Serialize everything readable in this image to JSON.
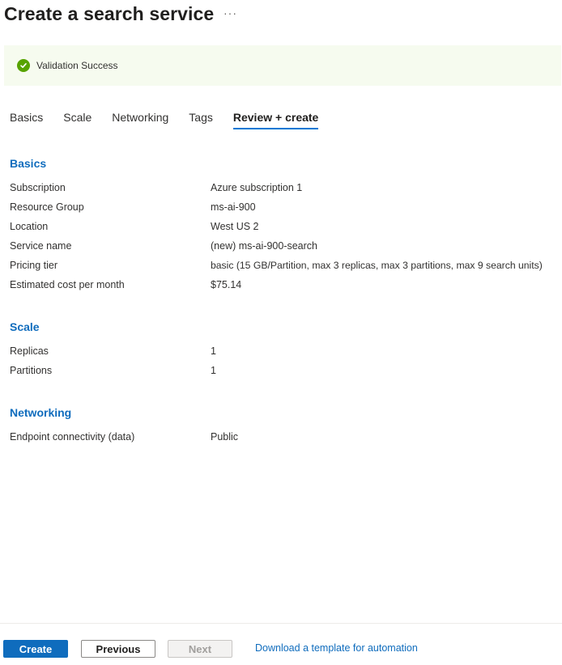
{
  "header": {
    "title": "Create a search service",
    "more_label": "···"
  },
  "banner": {
    "text": "Validation Success",
    "icon": "check-circle-icon",
    "color": "#57a300"
  },
  "tabs": [
    {
      "label": "Basics",
      "active": false
    },
    {
      "label": "Scale",
      "active": false
    },
    {
      "label": "Networking",
      "active": false
    },
    {
      "label": "Tags",
      "active": false
    },
    {
      "label": "Review + create",
      "active": true
    }
  ],
  "sections": {
    "basics": {
      "title": "Basics",
      "rows": [
        {
          "label": "Subscription",
          "value": "Azure subscription 1"
        },
        {
          "label": "Resource Group",
          "value": "ms-ai-900"
        },
        {
          "label": "Location",
          "value": "West US 2"
        },
        {
          "label": "Service name",
          "value": "(new) ms-ai-900-search"
        },
        {
          "label": "Pricing tier",
          "value": "basic (15 GB/Partition, max 3 replicas, max 3 partitions, max 9 search units)"
        },
        {
          "label": "Estimated cost per month",
          "value": "$75.14"
        }
      ]
    },
    "scale": {
      "title": "Scale",
      "rows": [
        {
          "label": "Replicas",
          "value": "1"
        },
        {
          "label": "Partitions",
          "value": "1"
        }
      ]
    },
    "networking": {
      "title": "Networking",
      "rows": [
        {
          "label": "Endpoint connectivity (data)",
          "value": "Public"
        }
      ]
    }
  },
  "footer": {
    "create_label": "Create",
    "previous_label": "Previous",
    "next_label": "Next",
    "download_label": "Download a template for automation"
  },
  "colors": {
    "accent": "#0f6cbd",
    "success": "#57a300",
    "banner_bg": "#f6fbef"
  }
}
